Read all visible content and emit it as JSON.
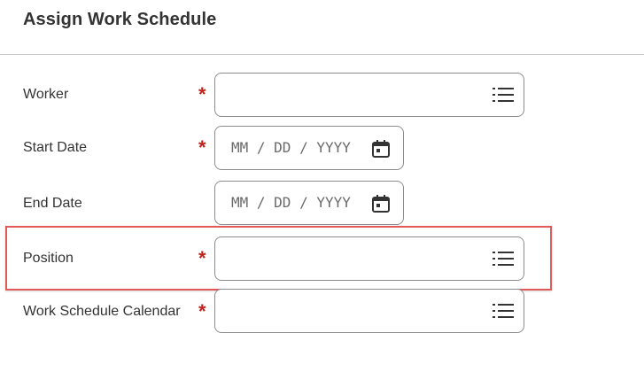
{
  "title": "Assign Work Schedule",
  "fields": {
    "worker": {
      "label": "Worker",
      "required_mark": "*",
      "value": ""
    },
    "start_date": {
      "label": "Start Date",
      "required_mark": "*",
      "placeholder": "MM / DD / YYYY"
    },
    "end_date": {
      "label": "End Date",
      "placeholder": "MM / DD / YYYY"
    },
    "position": {
      "label": "Position",
      "required_mark": "*",
      "value": ""
    },
    "work_schedule_calendar": {
      "label": "Work Schedule Calendar",
      "required_mark": "*",
      "value": ""
    }
  },
  "icons": {
    "prompt": "list-prompt-icon",
    "calendar": "calendar-icon"
  },
  "colors": {
    "required": "#c0221b",
    "highlight": "#e05a5a",
    "field_border": "#8c8c8c"
  }
}
